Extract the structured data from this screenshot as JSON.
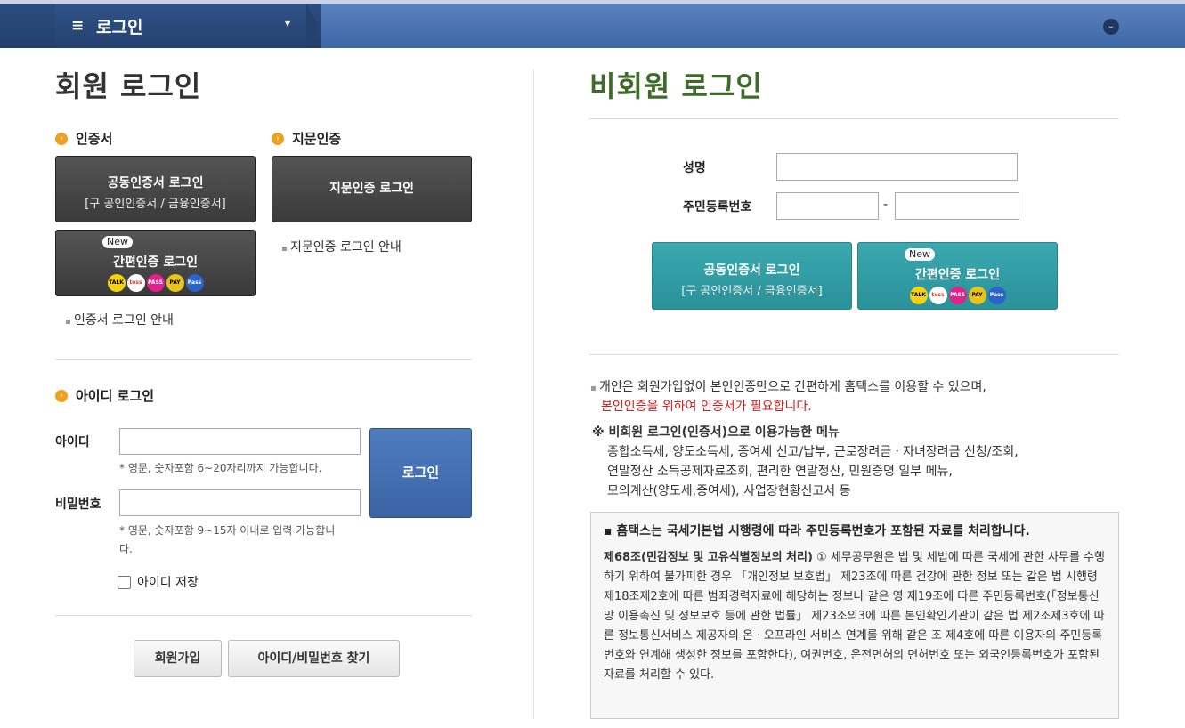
{
  "topbar": {
    "menu_icon": "≡",
    "title": "로그인",
    "caret": "▾",
    "circle": "⌄"
  },
  "member": {
    "heading": "회원 로그인",
    "cert_head": "인증서",
    "finger_head": "지문인증",
    "cert_btn_main": "공동인증서 로그인",
    "cert_btn_sub": "[구 공인인증서 / 금융인증서]",
    "finger_btn": "지문인증 로그인",
    "new_badge": "New",
    "simple_btn": "간편인증 로그인",
    "finger_guide": "지문인증 로그인 안내",
    "cert_guide": "인증서 로그인 안내",
    "id_head": "아이디 로그인",
    "id_label": "아이디",
    "id_value": "",
    "id_hint": "* 영문, 숫자포함 6~20자리까지 가능합니다.",
    "pw_label": "비밀번호",
    "pw_value": "",
    "pw_hint1": "* 영문, 숫자포함 9~15자 이내로 입력 가능합니",
    "pw_hint2": "다.",
    "login_btn": "로그인",
    "save_id": "아이디 저장",
    "join_btn": "회원가입",
    "find_btn": "아이디/비밀번호 찾기"
  },
  "nonmember": {
    "heading": "비회원 로그인",
    "name_label": "성명",
    "name_value": "",
    "rrn_label": "주민등록번호",
    "rrn_dash": "-",
    "rrn_front": "",
    "rrn_back": "",
    "cert_btn_main": "공동인증서 로그인",
    "cert_btn_sub": "[구 공인인증서 / 금융인증서]",
    "new_badge": "New",
    "simple_btn": "간편인증 로그인",
    "note1": "개인은 회원가입없이 본인인증만으로 간편하게 홈택스를 이용할 수 있으며,",
    "note2": "본인인증을 위하여 인증서가 필요합니다.",
    "menu_head": "※ 비회원 로그인(인증서)으로 이용가능한 메뉴",
    "menu_l1": "종합소득세, 양도소득세, 증여세 신고/납부, 근로장려금ㆍ자녀장려금 신청/조회,",
    "menu_l2": "연말정산 소득공제자료조회, 편리한 연말정산, 민원증명 일부 메뉴,",
    "menu_l3": "모의계산(양도세,증여세), 사업장현황신고서 등",
    "notice_title": "▪ 홈택스는 국세기본법 시행령에 따라 주민등록번호가 포함된 자료를 처리합니다.",
    "notice_bold": "제68조(민감정보 및 고유식별정보의 처리)",
    "notice_text": " ① 세무공무원은 법 및 세법에 따른 국세에 관한 사무를 수행하기 위하여 불가피한 경우 「개인정보 보호법」 제23조에 따른 건강에 관한 정보 또는 같은 법 시행령 제18조제2호에 따른 범죄경력자료에 해당하는 정보나 같은 영 제19조에 따른 주민등록번호(「정보통신망 이용촉진 및 정보보호 등에 관한 법률」 제23조의3에 따른 본인확인기관이 같은 법 제2조제3호에 따른 정보통신서비스 제공자의 온ㆍ오프라인 서비스 연계를 위해 같은 조 제4호에 따른 이용자의 주민등록번호와 연계해 생성한 정보를 포함한다), 여권번호, 운전면허의 면허번호 또는 외국인등록번호가 포함된 자료를 처리할 수 있다."
  },
  "auth_icons": [
    {
      "name": "kakao",
      "label": "TALK",
      "color": "#f5d30f"
    },
    {
      "name": "toss",
      "label": "toss",
      "color": "#ffffff"
    },
    {
      "name": "pass",
      "label": "PASS",
      "color": "#e2228c"
    },
    {
      "name": "payco",
      "label": "PAY",
      "color": "#e9c21a"
    },
    {
      "name": "samsungpass",
      "label": "Pass",
      "color": "#2a64c8"
    }
  ],
  "colors": {
    "accent_blue": "#3d67a6",
    "accent_teal": "#2a9199",
    "heading_green": "#3e6b2a"
  }
}
